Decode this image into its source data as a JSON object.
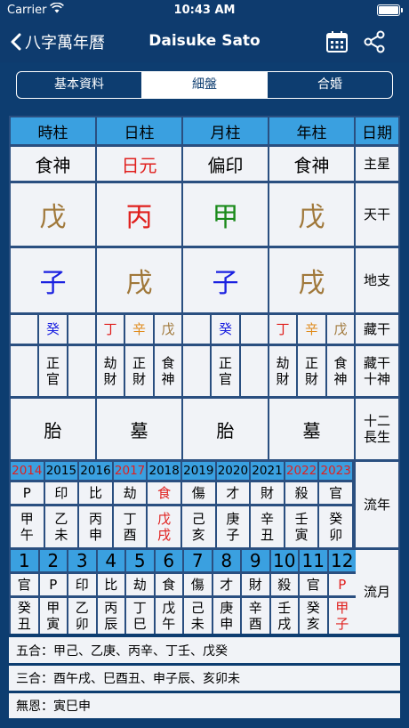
{
  "status": {
    "carrier": "Carrier",
    "time": "10:43 AM"
  },
  "nav": {
    "back_label": "八字萬年曆",
    "title": "Daisuke Sato"
  },
  "tabs": [
    {
      "label": "基本資料",
      "active": false
    },
    {
      "label": "細盤",
      "active": true
    },
    {
      "label": "合婚",
      "active": false
    }
  ],
  "pillars": {
    "headers": [
      "時柱",
      "日柱",
      "月柱",
      "年柱",
      "日期"
    ],
    "main_star": [
      "食神",
      "日元",
      "偏印",
      "食神"
    ],
    "main_star_label": "主星",
    "stems": [
      "戊",
      "丙",
      "甲",
      "戊"
    ],
    "stems_label": "天干",
    "branches": [
      "子",
      "戌",
      "子",
      "戌"
    ],
    "branches_label": "地支",
    "hidden_label": "藏干",
    "hidden_gods_label": "藏干\n十神",
    "life_stage": [
      "胎",
      "墓",
      "胎",
      "墓"
    ],
    "life_stage_label": "十二\n長生",
    "hidden": [
      [
        {
          "c": "",
          "g": ""
        },
        {
          "c": "癸",
          "g": "正\n官"
        },
        {
          "c": "",
          "g": ""
        }
      ],
      [
        {
          "c": "丁",
          "g": "劫\n財"
        },
        {
          "c": "辛",
          "g": "正\n財"
        },
        {
          "c": "戊",
          "g": "食\n神"
        }
      ],
      [
        {
          "c": "",
          "g": ""
        },
        {
          "c": "癸",
          "g": "正\n官"
        },
        {
          "c": "",
          "g": ""
        }
      ],
      [
        {
          "c": "丁",
          "g": "劫\n財"
        },
        {
          "c": "辛",
          "g": "正\n財"
        },
        {
          "c": "戊",
          "g": "食\n神"
        }
      ]
    ]
  },
  "annual": {
    "label": "流年",
    "years": [
      "2014",
      "2015",
      "2016",
      "2017",
      "2018",
      "2019",
      "2020",
      "2021",
      "2022",
      "2023"
    ],
    "gods": [
      "P",
      "印",
      "比",
      "劫",
      "食",
      "傷",
      "才",
      "財",
      "殺",
      "官"
    ],
    "ganzhi": [
      "甲\n午",
      "乙\n未",
      "丙\n申",
      "丁\n酉",
      "戊\n戌",
      "己\n亥",
      "庚\n子",
      "辛\n丑",
      "壬\n寅",
      "癸\n卯"
    ]
  },
  "monthly": {
    "label": "流月",
    "months": [
      "1",
      "2",
      "3",
      "4",
      "5",
      "6",
      "7",
      "8",
      "9",
      "10",
      "11",
      "12"
    ],
    "gods": [
      "官",
      "P",
      "印",
      "比",
      "劫",
      "食",
      "傷",
      "才",
      "財",
      "殺",
      "官",
      "P"
    ],
    "ganzhi": [
      "癸\n丑",
      "甲\n寅",
      "乙\n卯",
      "丙\n辰",
      "丁\n巳",
      "戊\n午",
      "己\n未",
      "庚\n申",
      "辛\n酉",
      "壬\n戌",
      "癸\n亥",
      "甲\n子"
    ]
  },
  "combos": {
    "wuhe": "五合：甲己、乙庚、丙辛、丁壬、戊癸",
    "sanhe": "三合：酉午戌、巳酉丑、申子辰、亥卯未",
    "wuen": "無恩：寅巳申"
  },
  "colors": {
    "earth": "#a0783a",
    "fire": "#e0201e",
    "wood": "#1a8a1a",
    "water": "#1a20e0",
    "metal": "#e08a1a",
    "header": "#3aa0e0",
    "background": "#0d3d70"
  }
}
